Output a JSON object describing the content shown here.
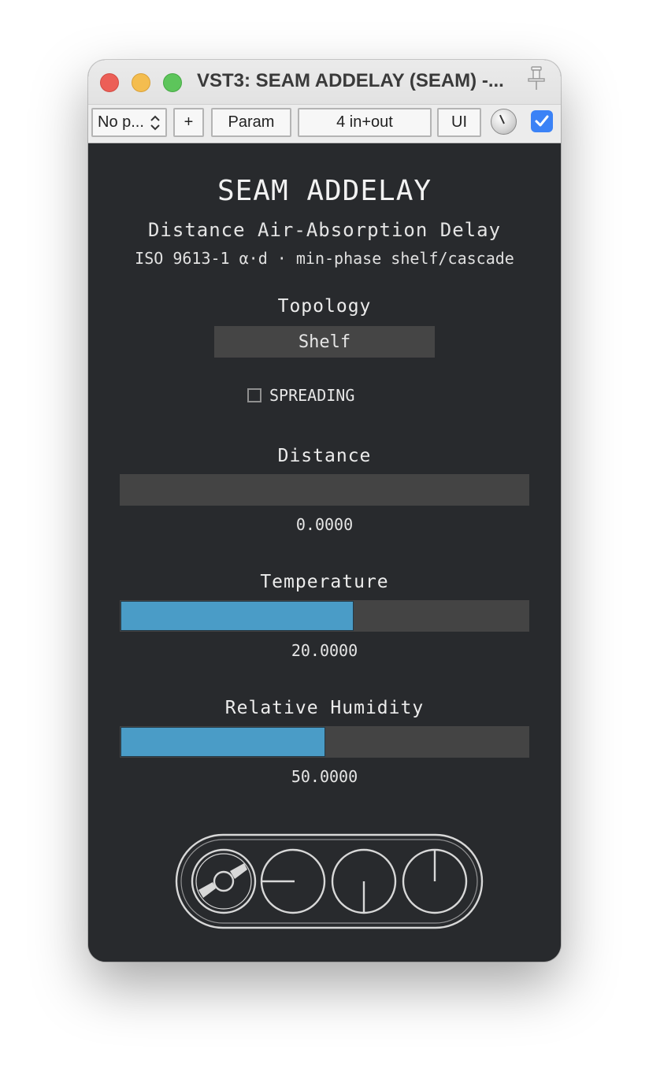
{
  "window": {
    "title": "VST3: SEAM ADDELAY (SEAM) -..."
  },
  "toolbar": {
    "preset_label": "No p...",
    "plus_label": "+",
    "param_label": "Param",
    "io_label": "4 in+out",
    "ui_label": "UI",
    "checkbox_checked": true
  },
  "plugin": {
    "title": "SEAM ADDELAY",
    "subtitle": "Distance Air-Absorption Delay",
    "subtitle2": "ISO 9613-1 α·d · min-phase shelf/cascade",
    "topology": {
      "label": "Topology",
      "value": "Shelf"
    },
    "spreading": {
      "label": "SPREADING",
      "checked": false
    },
    "params": [
      {
        "label": "Distance",
        "value": "0.0000",
        "fill_fraction": 0.0
      },
      {
        "label": "Temperature",
        "value": "20.0000",
        "fill_fraction": 0.57
      },
      {
        "label": "Relative Humidity",
        "value": "50.0000",
        "fill_fraction": 0.5
      }
    ]
  },
  "colors": {
    "background": "#282a2d",
    "slider_track": "#444444",
    "slider_fill": "#4a9cc7",
    "accent_check": "#3b82f6"
  },
  "icons": {
    "close": "close-light",
    "minimize": "minimize-light",
    "zoom": "zoom-light",
    "pin": "pin-icon",
    "stepper": "chevron-updown-icon",
    "knob": "knob-icon",
    "check": "checkmark-icon",
    "logo": "seam-logo"
  }
}
